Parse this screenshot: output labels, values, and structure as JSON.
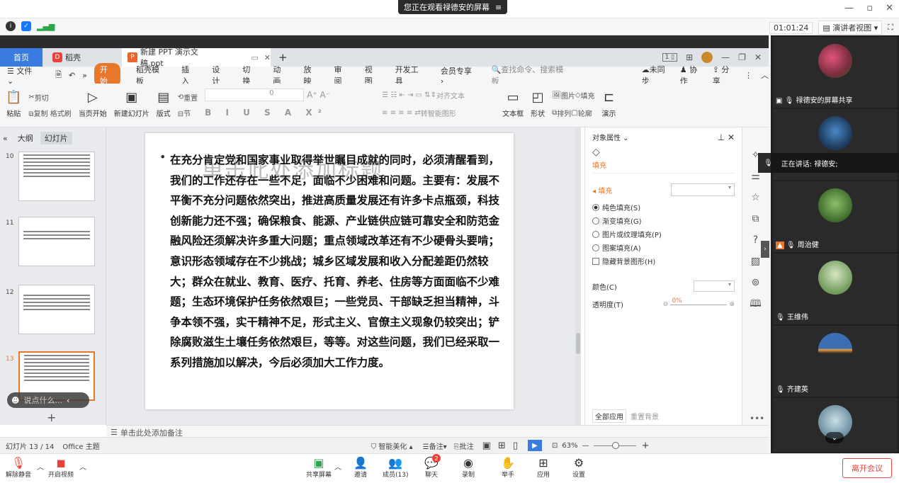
{
  "meeting": {
    "share_tip": "您正在观看禄德安的屏幕",
    "timer": "01:01:24",
    "presenter_view": "演讲者视图",
    "window_controls": [
      "minimize-icon",
      "restore-icon",
      "close-icon"
    ]
  },
  "wps": {
    "home_tab": "首页",
    "daoke_tab": "稻壳",
    "doc_tab": "新建 PPT 演示文稿.ppt",
    "menu": [
      "文件",
      "开始",
      "稻壳模板",
      "插入",
      "设计",
      "切换",
      "动画",
      "放映",
      "审阅",
      "视图",
      "开发工具",
      "会员专享"
    ],
    "search_placeholder": "查找命令、搜索模板",
    "sync": "未同步",
    "collab": "协作",
    "share": "分享",
    "ribbon": {
      "paste": "粘贴",
      "cut": "剪切",
      "copy": "复制",
      "format_painter": "格式刷",
      "start_from": "当页开始",
      "new_slide": "新建幻灯片",
      "layout": "版式",
      "section": "节",
      "reset": "重置",
      "font_size": "0",
      "align_text": "对齐文本",
      "convert_smartart": "转智能图形",
      "textbox": "文本框",
      "shape": "形状",
      "arrange": "排列",
      "picture": "图片",
      "fill": "填充",
      "outline": "轮廓",
      "present": "演示"
    },
    "panel_tabs": [
      "大纲",
      "幻灯片"
    ],
    "thumb_numbers": [
      "10",
      "11",
      "12",
      "13"
    ],
    "slide_title_placeholder": "单击此处添加标题",
    "slide_body": "在充分肯定党和国家事业取得举世瞩目成就的同时，必须清醒看到，我们的工作还存在一些不足，面临不少困难和问题。主要有：发展不平衡不充分问题依然突出，推进高质量发展还有许多卡点瓶颈，科技创新能力还不强；确保粮食、能源、产业链供应链可靠安全和防范金融风险还须解决许多重大问题；重点领域改革还有不少硬骨头要啃；意识形态领域存在不少挑战；城乡区域发展和收入分配差距仍然较大；群众在就业、教育、医疗、托育、养老、住房等方面面临不少难题；生态环境保护任务依然艰巨；一些党员、干部缺乏担当精神，斗争本领不强，实干精神不足，形式主义、官僚主义现象仍较突出；铲除腐败滋生土壤任务依然艰巨，等等。对这些问题，我们已经采取一系列措施加以解决，今后必须加大工作力度。",
    "props": {
      "title": "对象属性",
      "tab_fill": "填充",
      "section": "填充",
      "options": [
        "纯色填充(S)",
        "渐变填充(G)",
        "图片或纹理填充(P)",
        "图案填充(A)"
      ],
      "hide_bg": "隐藏背景图形(H)",
      "color_label": "颜色(C)",
      "transparency_label": "透明度(T)",
      "transparency_value": "0%",
      "apply_all": "全部应用",
      "reset_bg": "重置背景"
    },
    "chat_hint": "说点什么...",
    "notes_placeholder": "单击此处添加备注",
    "status": {
      "slide_counter": "幻灯片 13 / 14",
      "theme": "Office 主题",
      "smart": "智能美化",
      "notes": "备注",
      "comments": "批注",
      "zoom": "63%"
    }
  },
  "videos": {
    "share_label": "禄德安的屏幕共享",
    "speaking": "正在讲话: 禄德安;",
    "participants": [
      "周治健",
      "王维伟",
      "齐建英"
    ]
  },
  "controls": {
    "unmute": "解除静音",
    "video": "开启视频",
    "share_screen": "共享屏幕",
    "invite": "邀请",
    "members": "成员(13)",
    "chat": "聊天",
    "chat_badge": "2",
    "record": "录制",
    "raise_hand": "举手",
    "apps": "应用",
    "settings": "设置",
    "leave": "离开会议"
  }
}
